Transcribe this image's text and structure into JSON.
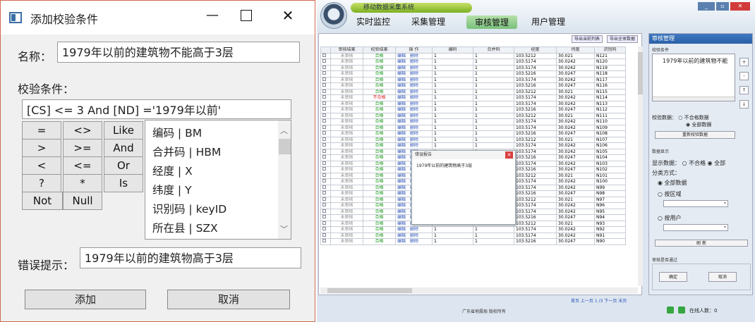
{
  "dialog": {
    "title": "添加校验条件",
    "min_icon": "minimize-icon",
    "max_icon": "maximize-icon",
    "close_icon": "close-icon",
    "name_label": "名称：",
    "name_value": "1979年以前的建筑物不能高于3层",
    "condition_label": "校验条件：",
    "condition_value": "[CS] <= 3 And  [ND] ='1979年以前'",
    "keypad": [
      "=",
      "<>",
      "Like",
      ">",
      ">=",
      "And",
      "<",
      "<=",
      "Or",
      "?",
      "*",
      "Is",
      "Not",
      "Null"
    ],
    "fields": [
      "编码 | BM",
      "合并码 | HBM",
      "经度 | X",
      "纬度 | Y",
      "识别码 | keyID",
      "所在县 | SZX"
    ],
    "error_label": "错误提示：",
    "error_value": "1979年以前的建筑物高于3层",
    "add_label": "添加",
    "cancel_label": "取消"
  },
  "app": {
    "system_name": "移动数据采集系统",
    "tabs": [
      "实时监控",
      "采集管理",
      "审核管理",
      "用户管理"
    ],
    "active_tab": "审核管理",
    "export_current": "导出当前列表",
    "export_all": "导出全体数据",
    "columns": [
      "审核结果",
      "校验结果",
      "操 作",
      "编码",
      "合并码",
      "经度",
      "纬度",
      "识别码"
    ],
    "rows": [
      [
        "未审核",
        "合格",
        "1",
        "1",
        "103.5212",
        "30.021",
        "N121"
      ],
      [
        "未审核",
        "合格",
        "1",
        "1",
        "103.5174",
        "30.0242",
        "N120"
      ],
      [
        "未审核",
        "合格",
        "1",
        "1",
        "103.5174",
        "30.0242",
        "N119"
      ],
      [
        "未审核",
        "合格",
        "1",
        "1",
        "103.5216",
        "30.0247",
        "N118"
      ],
      [
        "未审核",
        "合格",
        "1",
        "1",
        "103.5174",
        "30.0242",
        "N117"
      ],
      [
        "未审核",
        "合格",
        "1",
        "1",
        "103.5216",
        "30.0247",
        "N116"
      ],
      [
        "未审核",
        "合格",
        "1",
        "1",
        "103.5212",
        "30.021",
        "N115"
      ],
      [
        "未审核",
        "不合格",
        "1",
        "1",
        "103.5174",
        "30.0242",
        "N114"
      ],
      [
        "未审核",
        "合格",
        "1",
        "1",
        "103.5174",
        "30.0242",
        "N113"
      ],
      [
        "未审核",
        "合格",
        "1",
        "1",
        "103.5216",
        "30.0247",
        "N112"
      ],
      [
        "未审核",
        "合格",
        "1",
        "1",
        "103.5212",
        "30.021",
        "N111"
      ],
      [
        "未审核",
        "合格",
        "1",
        "1",
        "103.5174",
        "30.0242",
        "N110"
      ],
      [
        "未审核",
        "合格",
        "1",
        "1",
        "103.5174",
        "30.0242",
        "N109"
      ],
      [
        "未审核",
        "合格",
        "1",
        "1",
        "103.5216",
        "30.0247",
        "N108"
      ],
      [
        "未审核",
        "合格",
        "1",
        "1",
        "103.5212",
        "30.021",
        "N107"
      ],
      [
        "未审核",
        "合格",
        "1",
        "1",
        "103.5174",
        "30.0242",
        "N106"
      ],
      [
        "未审核",
        "合格",
        "1",
        "1",
        "103.5174",
        "30.0242",
        "N105"
      ],
      [
        "未审核",
        "合格",
        "1",
        "1",
        "103.5216",
        "30.0247",
        "N104"
      ],
      [
        "未审核",
        "合格",
        "1",
        "1",
        "103.5174",
        "30.0242",
        "N103"
      ],
      [
        "未审核",
        "合格",
        "1",
        "1",
        "103.5216",
        "30.0247",
        "N102"
      ],
      [
        "未审核",
        "合格",
        "1",
        "1",
        "103.5212",
        "30.021",
        "N101"
      ],
      [
        "未审核",
        "合格",
        "1",
        "1",
        "103.5174",
        "30.0242",
        "N100"
      ],
      [
        "未审核",
        "合格",
        "1",
        "1",
        "103.5174",
        "30.0242",
        "N99"
      ],
      [
        "未审核",
        "合格",
        "1",
        "1",
        "103.5216",
        "30.0247",
        "N98"
      ],
      [
        "未审核",
        "合格",
        "1",
        "1",
        "103.5212",
        "30.021",
        "N97"
      ],
      [
        "未审核",
        "合格",
        "1",
        "1",
        "103.5174",
        "30.0242",
        "N96"
      ],
      [
        "未审核",
        "合格",
        "1",
        "1",
        "103.5174",
        "30.0242",
        "N95"
      ],
      [
        "未审核",
        "合格",
        "1",
        "1",
        "103.5216",
        "30.0247",
        "N94"
      ],
      [
        "未审核",
        "合格",
        "1",
        "1",
        "103.5212",
        "30.021",
        "N93"
      ],
      [
        "未审核",
        "合格",
        "1",
        "1",
        "103.5174",
        "30.0242",
        "N92"
      ],
      [
        "未审核",
        "合格",
        "1",
        "1",
        "103.5174",
        "30.0242",
        "N91"
      ],
      [
        "未审核",
        "合格",
        "1",
        "1",
        "103.5216",
        "30.0247",
        "N90"
      ]
    ],
    "edit_label": "编辑",
    "delete_label": "删除",
    "pager": "首页  上一页   1 /3  下一页  末页",
    "footer": "广东省地震局 版权所有",
    "popup_title": "错误报告",
    "popup_message": "1979年以前的建筑物高于3层",
    "panel": {
      "title": "审核管理",
      "check_condition": "校验条件",
      "condition_item": "1979年以前的建筑物不能",
      "check_data": "校验数据：",
      "opt_fail": "不合格数据",
      "opt_all": "全部数据",
      "recheck": "重新校验数据",
      "data_display": "数据显示",
      "display_data": "显示数据：",
      "display_fail": "不合格",
      "display_all": "全部",
      "classify": "分类方式：",
      "by_all": "全部数据",
      "by_area": "按区域",
      "by_user": "按用户",
      "refresh": "刷  新",
      "pass_label": "审核是否通过",
      "confirm": "确定",
      "back": "取消",
      "online": "在线人数：0"
    }
  }
}
